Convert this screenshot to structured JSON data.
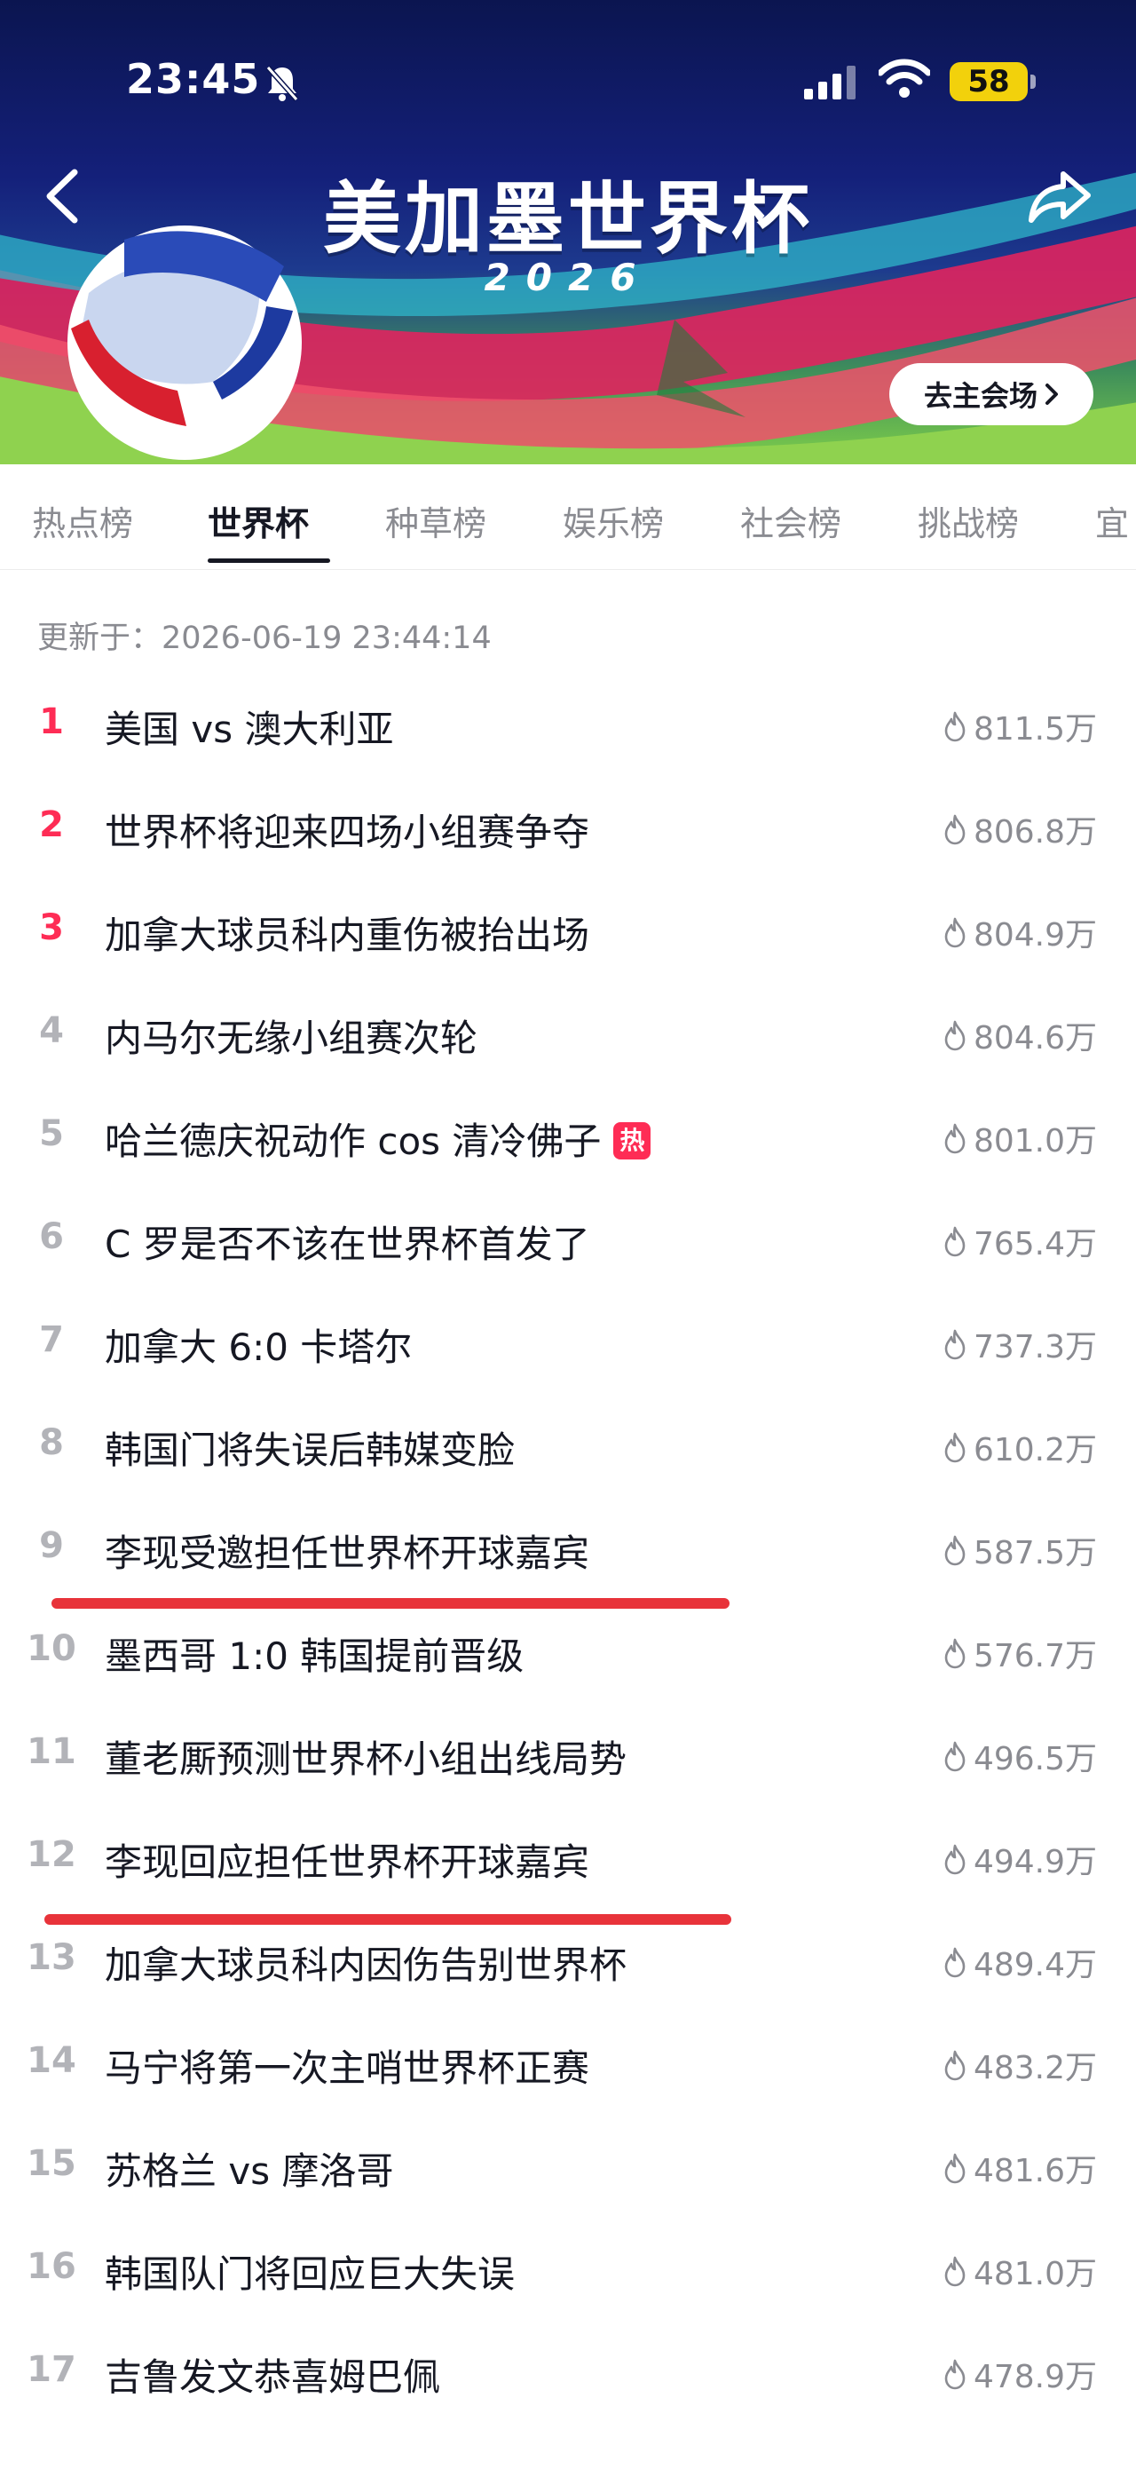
{
  "status_bar": {
    "time": "23:45",
    "battery": "58"
  },
  "banner": {
    "title": "美加墨世界杯",
    "year": "2026",
    "venue_button": "去主会场"
  },
  "tabs": [
    {
      "label": "热点榜",
      "active": false
    },
    {
      "label": "世界杯",
      "active": true
    },
    {
      "label": "种草榜",
      "active": false
    },
    {
      "label": "娱乐榜",
      "active": false
    },
    {
      "label": "社会榜",
      "active": false
    },
    {
      "label": "挑战榜",
      "active": false
    },
    {
      "label": "宜",
      "active": false
    }
  ],
  "update_time": "更新于：2026-06-19 23:44:14",
  "list": [
    {
      "rank": "1",
      "title": "美国 vs 澳大利亚",
      "heat": "811.5万"
    },
    {
      "rank": "2",
      "title": "世界杯将迎来四场小组赛争夺",
      "heat": "806.8万"
    },
    {
      "rank": "3",
      "title": "加拿大球员科内重伤被抬出场",
      "heat": "804.9万"
    },
    {
      "rank": "4",
      "title": "内马尔无缘小组赛次轮",
      "heat": "804.6万"
    },
    {
      "rank": "5",
      "title": "哈兰德庆祝动作 cos 清冷佛子",
      "heat": "801.0万",
      "badge": "热"
    },
    {
      "rank": "6",
      "title": "C 罗是否不该在世界杯首发了",
      "heat": "765.4万"
    },
    {
      "rank": "7",
      "title": "加拿大 6:0 卡塔尔",
      "heat": "737.3万"
    },
    {
      "rank": "8",
      "title": "韩国门将失误后韩媒变脸",
      "heat": "610.2万"
    },
    {
      "rank": "9",
      "title": "李现受邀担任世界杯开球嘉宾",
      "heat": "587.5万"
    },
    {
      "rank": "10",
      "title": "墨西哥 1:0 韩国提前晋级",
      "heat": "576.7万"
    },
    {
      "rank": "11",
      "title": "董老厮预测世界杯小组出线局势",
      "heat": "496.5万"
    },
    {
      "rank": "12",
      "title": "李现回应担任世界杯开球嘉宾",
      "heat": "494.9万"
    },
    {
      "rank": "13",
      "title": "加拿大球员科内因伤告别世界杯",
      "heat": "489.4万"
    },
    {
      "rank": "14",
      "title": "马宁将第一次主哨世界杯正赛",
      "heat": "483.2万"
    },
    {
      "rank": "15",
      "title": "苏格兰 vs 摩洛哥",
      "heat": "481.6万"
    },
    {
      "rank": "16",
      "title": "韩国队门将回应巨大失误",
      "heat": "481.0万"
    },
    {
      "rank": "17",
      "title": "吉鲁发文恭喜姆巴佩",
      "heat": "478.9万"
    }
  ],
  "colors": {
    "accent": "#fe2c55",
    "annotation": "#e8333a",
    "badge_bg": "#f2d10c"
  }
}
